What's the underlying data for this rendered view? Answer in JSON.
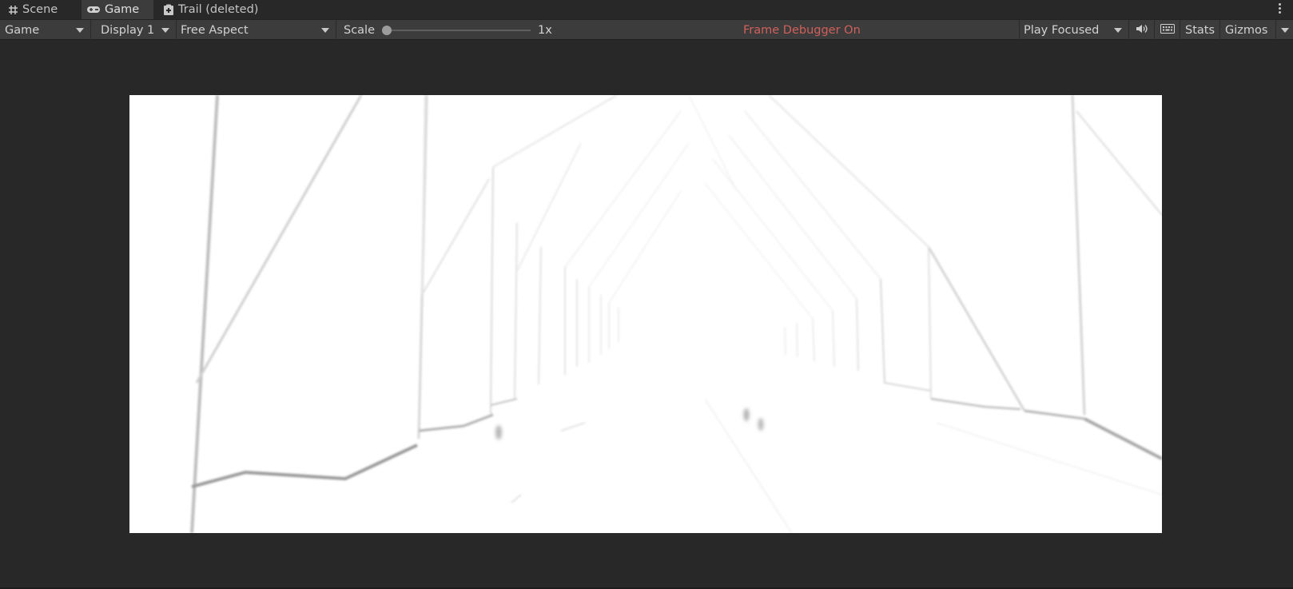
{
  "tabs": [
    {
      "label": "Scene",
      "icon": "grid-icon",
      "active": false
    },
    {
      "label": "Game",
      "icon": "gamepad-icon",
      "active": true
    },
    {
      "label": "Trail (deleted)",
      "icon": "clipboard-icon",
      "active": false
    }
  ],
  "toolbar": {
    "view_mode": "Game",
    "display": "Display 1",
    "aspect": "Free Aspect",
    "scale_label": "Scale",
    "scale_value": "1x",
    "scale_level": 0,
    "frame_debugger": "Frame Debugger On",
    "play_mode": "Play Focused",
    "audio_icon": "speaker-icon",
    "keyboard_icon": "keyboard-icon",
    "stats": "Stats",
    "gizmos": "Gizmos"
  },
  "colors": {
    "frame_debugger": "#d0605b",
    "toolbar_bg": "#3c3c3c",
    "window_bg": "#282828",
    "game_view_bg": "#ffffff"
  }
}
